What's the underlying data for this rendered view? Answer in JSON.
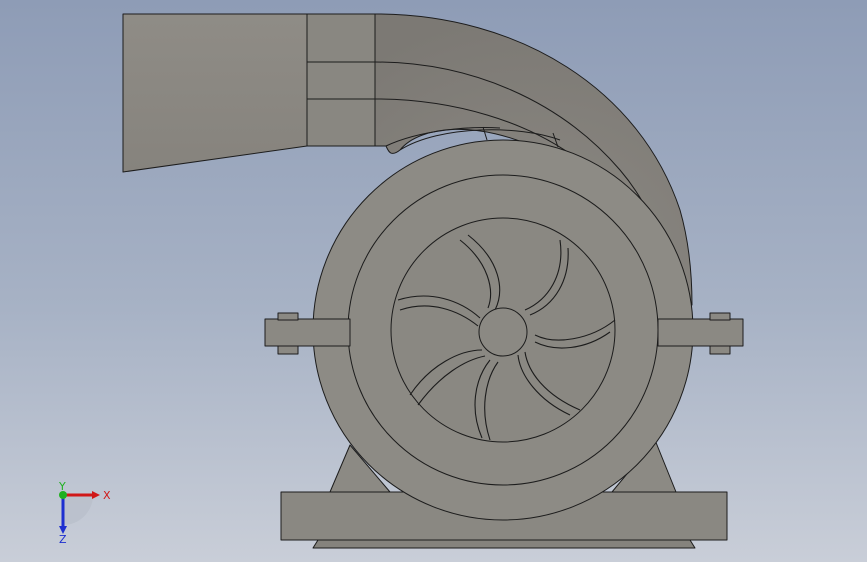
{
  "triad": {
    "x_label": "X",
    "y_label": "Y",
    "z_label": "Z",
    "x_color": "#d01818",
    "y_color": "#20b020",
    "z_color": "#1d2fd0"
  },
  "model": {
    "body_color": "#8c8a84",
    "edge_color": "#1c1c1c"
  }
}
